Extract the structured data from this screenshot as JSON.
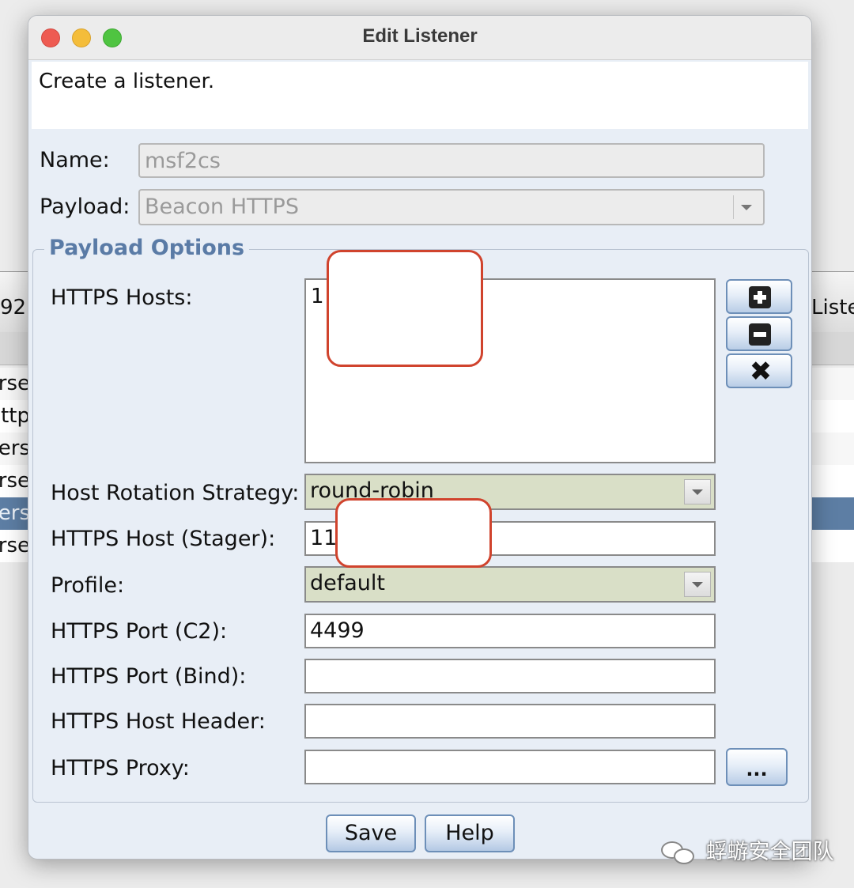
{
  "background": {
    "left_tab_text": "92.",
    "right_tab_text": "Liste",
    "left_rows": [
      "erse",
      "http",
      "vers",
      "erse",
      "vers",
      "erse"
    ],
    "right_rows": [
      "",
      "",
      "",
      "",
      "",
      ""
    ]
  },
  "dialog": {
    "title": "Edit Listener",
    "description": "Create a listener.",
    "name_label": "Name:",
    "name_value": "msf2cs",
    "payload_label": "Payload:",
    "payload_value": "Beacon HTTPS",
    "group_title": "Payload Options",
    "https_hosts_label": "HTTPS Hosts:",
    "https_hosts_value": "1",
    "rotation_label": "Host Rotation Strategy:",
    "rotation_value": "round-robin",
    "stager_label": "HTTPS Host (Stager):",
    "stager_value": "11",
    "profile_label": "Profile:",
    "profile_value": "default",
    "port_c2_label": "HTTPS Port (C2):",
    "port_c2_value": "4499",
    "port_bind_label": "HTTPS Port (Bind):",
    "port_bind_value": "",
    "host_header_label": "HTTPS Host Header:",
    "host_header_value": "",
    "proxy_label": "HTTPS Proxy:",
    "proxy_value": "",
    "proxy_button_label": "...",
    "save_label": "Save",
    "help_label": "Help"
  },
  "watermark": "蜉蝣安全团队",
  "icons": {
    "add": "plus-icon",
    "remove": "minus-icon",
    "clear": "close-icon"
  },
  "colors": {
    "group_title": "#5a7ba6",
    "redaction_border": "#d0432d",
    "select_bg": "#d9dfc7",
    "selected_row": "#5d7ea4"
  }
}
